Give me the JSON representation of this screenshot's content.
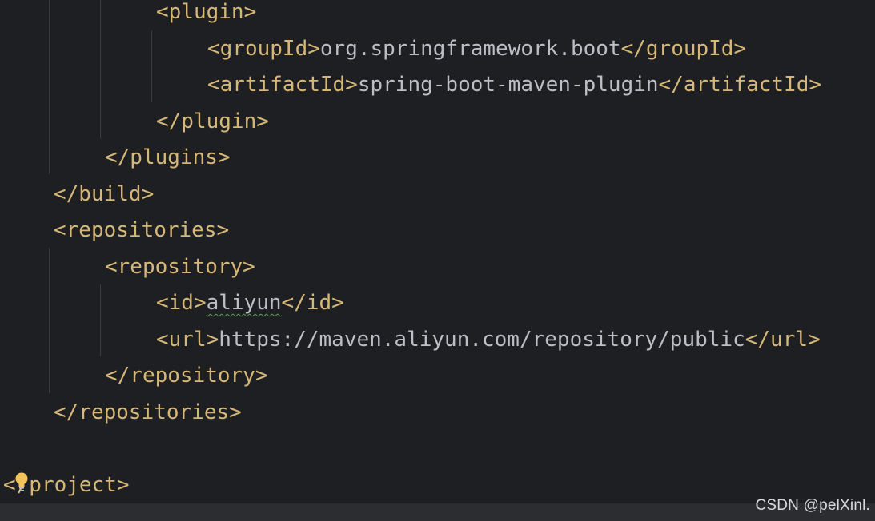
{
  "editor": {
    "lines": {
      "l1": {
        "open": "<plugin>"
      },
      "l2": {
        "open": "<groupId>",
        "text": "org.springframework.boot",
        "close": "</groupId>"
      },
      "l3": {
        "open": "<artifactId>",
        "text": "spring-boot-maven-plugin",
        "close": "</artifactId>"
      },
      "l4": {
        "close": "</plugin>"
      },
      "l5": {
        "close": "</plugins>"
      },
      "l6": {
        "close": "</build>"
      },
      "l7": {
        "open": "<repositories>"
      },
      "l8": {
        "open": "<repository>"
      },
      "l9": {
        "open": "<id>",
        "text": "aliyun",
        "close": "</id>"
      },
      "l10": {
        "open": "<url>",
        "text": "https://maven.aliyun.com/repository/public",
        "close": "</url>"
      },
      "l11": {
        "close": "</repository>"
      },
      "l12": {
        "close": "</repositories>"
      },
      "l13": {
        "open_a": "<",
        "open_b": "/project>"
      }
    },
    "colors": {
      "background": "#1e1f22",
      "tag": "#d5b778",
      "text": "#bcbec4",
      "typo_squiggle": "#5f9e5b",
      "bulb": "#f2c55c"
    },
    "icons": {
      "intention_bulb": "lightbulb-icon"
    }
  },
  "watermark": {
    "text": "CSDN @pelXinl."
  }
}
